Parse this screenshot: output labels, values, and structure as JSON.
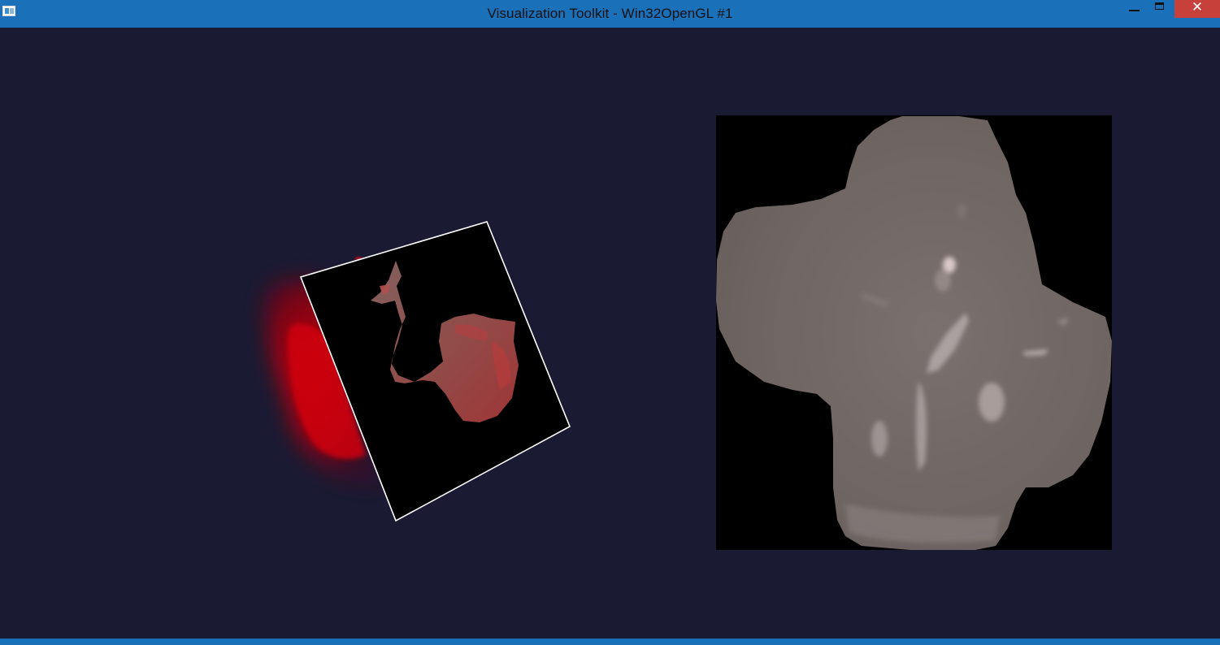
{
  "window": {
    "title": "Visualization Toolkit - Win32OpenGL #1",
    "close_glyph": "✕",
    "titlebar_color": "#1a70b9",
    "background_color": "#1b1a33"
  },
  "icons": {
    "app": "vtk-window-icon",
    "minimize": "minimize-icon",
    "maximize": "maximize-icon",
    "close": "close-icon"
  },
  "scene": {
    "left_view": "rotated-slice-plane-with-red-volume",
    "right_view": "axial-slice-image-grayscale",
    "volume_color": "#b00010",
    "slice_outline_color": "#ffffff",
    "tissue_color": "#6e6462"
  }
}
